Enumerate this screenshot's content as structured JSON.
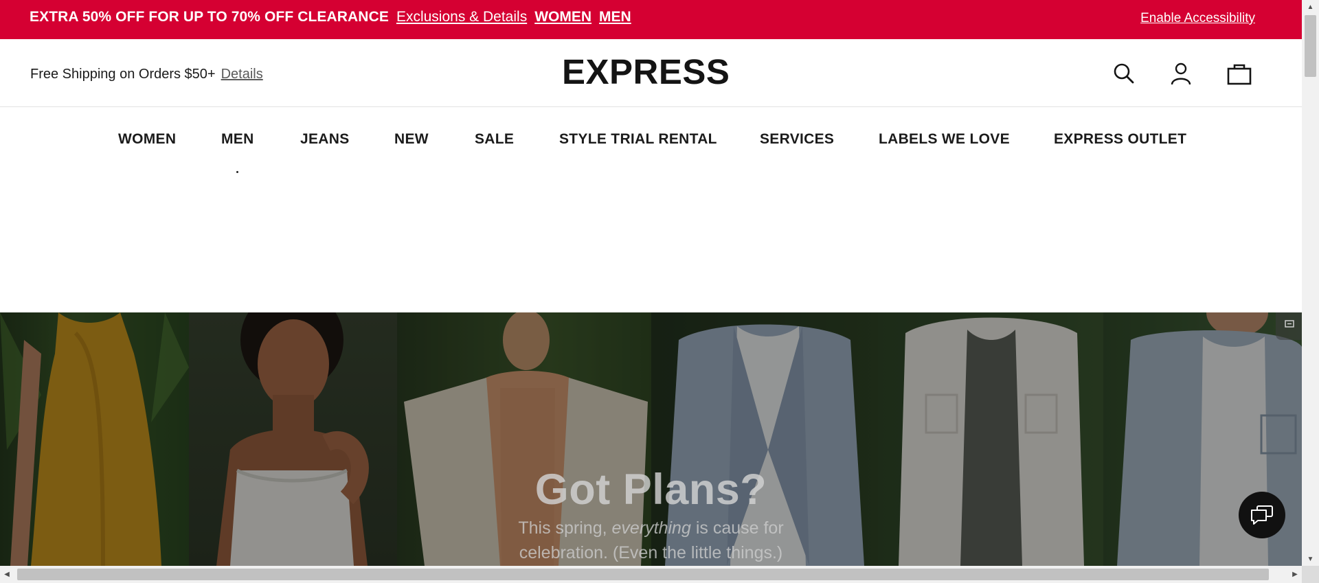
{
  "promo": {
    "text": "EXTRA 50% OFF FOR UP TO 70% OFF CLEARANCE",
    "details_link": "Exclusions & Details",
    "women_link": "WOMEN",
    "men_link": "MEN",
    "accessibility": "Enable Accessibility",
    "background_color": "#d50032"
  },
  "header": {
    "shipping_text": "Free Shipping on Orders $50+",
    "shipping_details": "Details",
    "logo": "EXPRESS",
    "icons": [
      "search-icon",
      "account-icon",
      "shopping-bag-icon"
    ]
  },
  "nav": {
    "items": [
      "WOMEN",
      "MEN",
      "JEANS",
      "NEW",
      "SALE",
      "STYLE TRIAL RENTAL",
      "SERVICES",
      "LABELS WE LOVE",
      "EXPRESS OUTLET"
    ]
  },
  "hero": {
    "title": "Got Plans?",
    "subtitle_pre": "This spring, ",
    "subtitle_em": "everything",
    "subtitle_post": " is cause for",
    "subtitle_line2": "celebration. (Even the little things.)"
  },
  "chat": {
    "icon": "chat-bubble-icon"
  }
}
